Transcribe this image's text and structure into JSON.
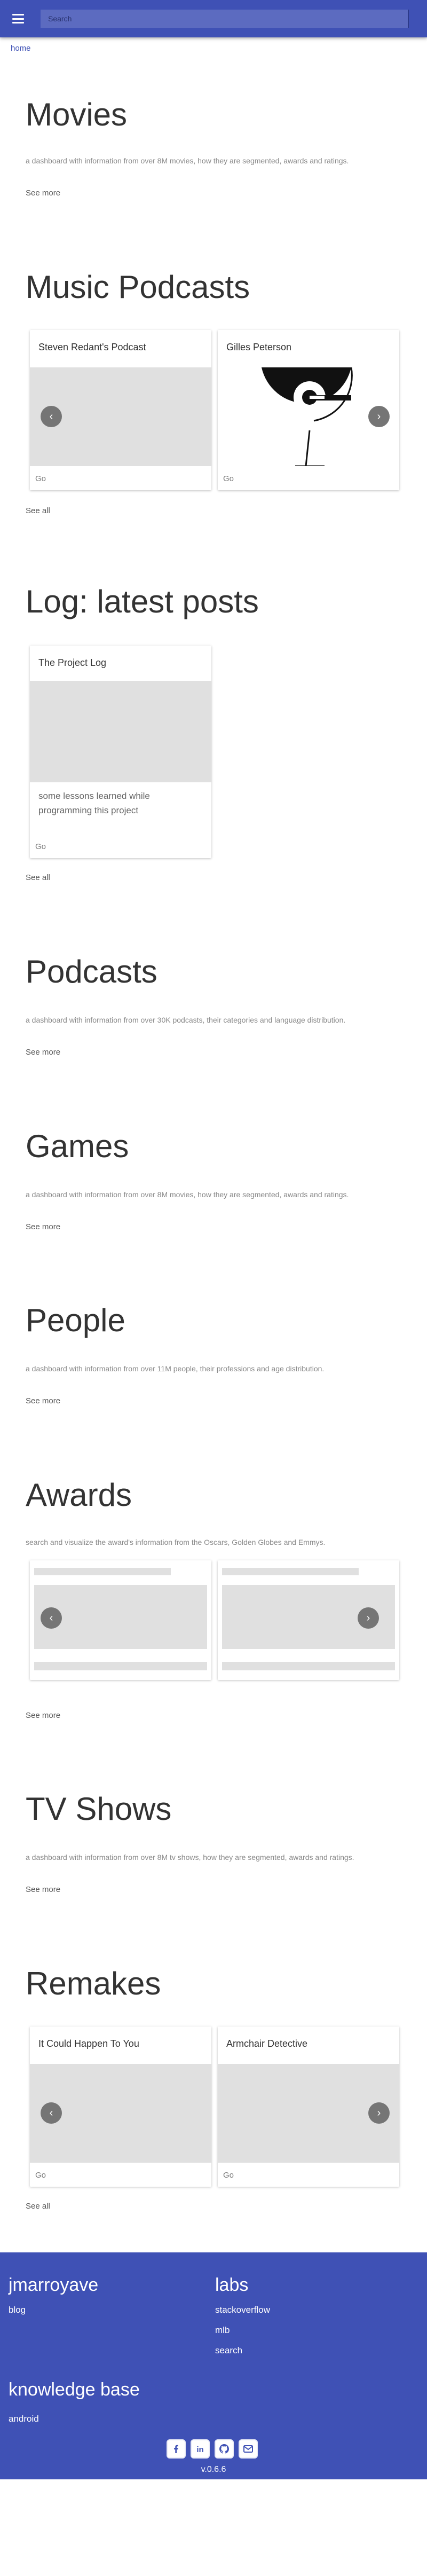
{
  "header": {
    "search_placeholder": "Search"
  },
  "breadcrumb": "home",
  "movies": {
    "title": "Movies",
    "description": "a dashboard with information from over 8M movies, how they are segmented, awards and ratings.",
    "more": "See more"
  },
  "music_podcasts": {
    "title": "Music Podcasts",
    "cards": [
      {
        "title": "Steven Redant's Podcast",
        "go": "Go"
      },
      {
        "title": "Gilles Peterson",
        "go": "Go"
      }
    ],
    "more": "See all"
  },
  "log": {
    "title": "Log: latest posts",
    "card_title": "The Project Log",
    "card_text": "some lessons learned while programming this project",
    "go": "Go",
    "more": "See all"
  },
  "podcasts": {
    "title": "Podcasts",
    "description": "a dashboard with information from over 30K podcasts, their categories and language distribution.",
    "more": "See more"
  },
  "games": {
    "title": "Games",
    "description": "a dashboard with information from over 8M movies, how they are segmented, awards and ratings.",
    "more": "See more"
  },
  "people": {
    "title": "People",
    "description": "a dashboard with information from over 11M people, their professions and age distribution.",
    "more": "See more"
  },
  "awards": {
    "title": "Awards",
    "description": "search and visualize the award's information from the Oscars, Golden Globes and Emmys.",
    "more": "See more"
  },
  "tvshows": {
    "title": "TV Shows",
    "description": "a dashboard with information from over 8M tv shows, how they are segmented, awards and ratings.",
    "more": "See more"
  },
  "remakes": {
    "title": "Remakes",
    "cards": [
      {
        "title": "It Could Happen To You",
        "go": "Go"
      },
      {
        "title": "Armchair Detective",
        "go": "Go"
      }
    ],
    "more": "See all"
  },
  "footer": {
    "col1_heading": "jmarroyave",
    "blog": "blog",
    "col2_heading": "labs",
    "stackoverflow": "stackoverflow",
    "mlb": "mlb",
    "search": "search",
    "kb_heading": "knowledge base",
    "android": "android",
    "version": "v.0.6.6"
  },
  "icons": {
    "prev": "‹",
    "next": "›",
    "linkedin": "in",
    "github": "github-icon",
    "email": "email-icon"
  },
  "colors": {
    "primary": "#3f51b5",
    "placeholder_gray": "#e0e0e0"
  }
}
